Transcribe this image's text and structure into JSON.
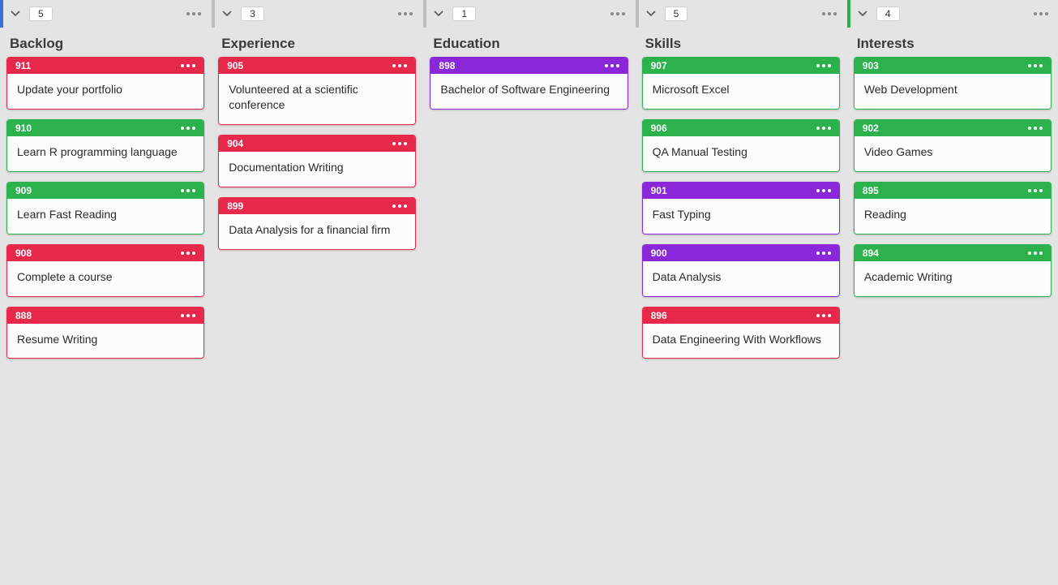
{
  "colors": {
    "red": "#e6294b",
    "green": "#2bb24c",
    "purple": "#8a27d8",
    "blue_accent": "#3b6fd8"
  },
  "columns": [
    {
      "accent": "blue",
      "count": "5",
      "title": "Backlog",
      "cards": [
        {
          "id": "911",
          "color": "red",
          "text": "Update your portfolio"
        },
        {
          "id": "910",
          "color": "green",
          "text": "Learn R programming language"
        },
        {
          "id": "909",
          "color": "green",
          "text": "Learn Fast Reading"
        },
        {
          "id": "908",
          "color": "red",
          "text": "Complete a course"
        },
        {
          "id": "888",
          "color": "red",
          "text": "Resume Writing"
        }
      ]
    },
    {
      "accent": "grey",
      "count": "3",
      "title": "Experience",
      "cards": [
        {
          "id": "905",
          "color": "red",
          "text": "Volunteered at a scientific conference"
        },
        {
          "id": "904",
          "color": "red",
          "text": "Documentation Writing"
        },
        {
          "id": "899",
          "color": "red",
          "text": "Data Analysis for a financial firm"
        }
      ]
    },
    {
      "accent": "grey",
      "count": "1",
      "title": "Education",
      "cards": [
        {
          "id": "898",
          "color": "purple",
          "text": "Bachelor of Software Engineering"
        }
      ]
    },
    {
      "accent": "grey",
      "count": "5",
      "title": "Skills",
      "cards": [
        {
          "id": "907",
          "color": "green",
          "text": "Microsoft Excel"
        },
        {
          "id": "906",
          "color": "green",
          "text": "QA Manual Testing"
        },
        {
          "id": "901",
          "color": "purple",
          "text": "Fast Typing"
        },
        {
          "id": "900",
          "color": "purple",
          "text": "Data Analysis"
        },
        {
          "id": "896",
          "color": "red",
          "text": "Data Engineering With Workflows"
        }
      ]
    },
    {
      "accent": "green",
      "count": "4",
      "title": "Interests",
      "cards": [
        {
          "id": "903",
          "color": "green",
          "text": "Web Development"
        },
        {
          "id": "902",
          "color": "green",
          "text": "Video Games"
        },
        {
          "id": "895",
          "color": "green",
          "text": "Reading"
        },
        {
          "id": "894",
          "color": "green",
          "text": "Academic Writing"
        }
      ]
    }
  ]
}
